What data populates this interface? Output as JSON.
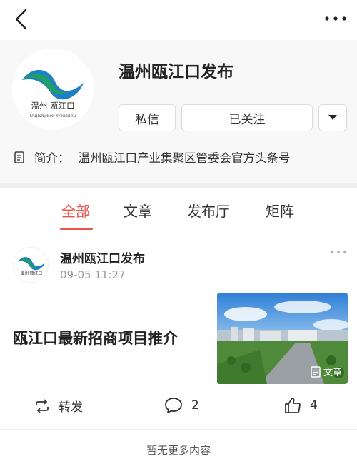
{
  "header": {
    "back_icon": "back-chevron-icon",
    "more_icon": "more-dots-icon"
  },
  "profile": {
    "name": "温州瓯江口发布",
    "avatar_logo_text": "温州·瓯江口",
    "avatar_logo_subtext": "Oujiangkou Wenzhou",
    "message_button": "私信",
    "follow_button": "已关注",
    "dropdown_icon": "triangle-down-icon",
    "intro_label": "简介：",
    "intro_text": "温州瓯江口产业集聚区管委会官方头条号"
  },
  "tabs": [
    {
      "label": "全部",
      "active": true
    },
    {
      "label": "文章",
      "active": false
    },
    {
      "label": "发布厅",
      "active": false
    },
    {
      "label": "矩阵",
      "active": false
    }
  ],
  "feed": [
    {
      "author": "温州瓯江口发布",
      "time": "09-05 11:27",
      "title": "瓯江口最新招商项目推介",
      "thumb_badge": "文章",
      "actions": {
        "repost_label": "转发",
        "comments": "2",
        "likes": "4"
      }
    }
  ],
  "footer": {
    "text": "暂无更多内容"
  },
  "colors": {
    "accent": "#e8534a",
    "logo_green": "#1f9e6a",
    "logo_blue": "#1d7fc4"
  }
}
